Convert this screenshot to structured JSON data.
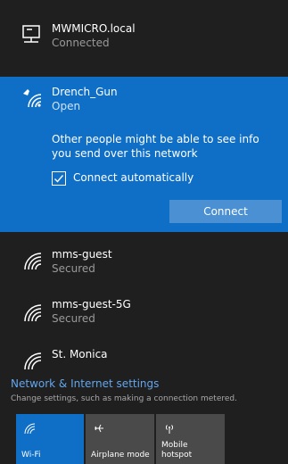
{
  "networks": {
    "wired": {
      "name": "MWMICRO.local",
      "status": "Connected"
    },
    "selected": {
      "name": "Drench_Gun",
      "status": "Open",
      "warning": "Other people might be able to see info you send over this network",
      "auto_connect_label": "Connect automatically",
      "auto_connect_checked": true,
      "connect_label": "Connect"
    },
    "list": [
      {
        "name": "mms-guest",
        "status": "Secured"
      },
      {
        "name": "mms-guest-5G",
        "status": "Secured"
      },
      {
        "name": "St. Monica",
        "status": ""
      }
    ]
  },
  "settings": {
    "link": "Network & Internet settings",
    "description": "Change settings, such as making a connection metered."
  },
  "quick_actions": [
    {
      "label": "Wi-Fi",
      "icon": "wifi-icon",
      "active": true
    },
    {
      "label": "Airplane mode",
      "icon": "airplane-icon",
      "active": false
    },
    {
      "label": "Mobile\nhotspot",
      "icon": "hotspot-icon",
      "active": false
    }
  ],
  "colors": {
    "accent": "#0f6fc6",
    "background": "#1f1f1f",
    "link": "#63a6ee"
  }
}
